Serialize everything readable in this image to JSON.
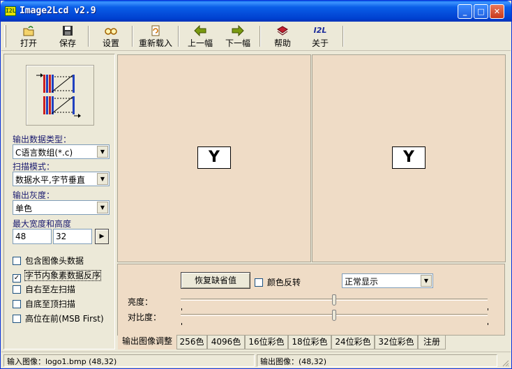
{
  "window": {
    "title": "Image2Lcd v2.9",
    "icon_text": "I2L",
    "min": "_",
    "max": "□",
    "close": "✕"
  },
  "toolbar": [
    {
      "label": "打开",
      "icon": "open-folder-icon"
    },
    {
      "label": "保存",
      "icon": "floppy-disk-icon"
    },
    {
      "label": "设置",
      "icon": "glasses-icon"
    },
    {
      "label": "重新载入",
      "icon": "reload-page-icon"
    },
    {
      "label": "上一幅",
      "icon": "arrow-left-icon"
    },
    {
      "label": "下一幅",
      "icon": "arrow-right-icon"
    },
    {
      "label": "帮助",
      "icon": "help-book-icon"
    },
    {
      "label": "关于",
      "icon": "about-logo-icon",
      "glyph": "I2L"
    }
  ],
  "left": {
    "output_type_label": "输出数据类型：",
    "output_type_value": "C语言数组(*.c)",
    "scan_mode_label": "扫描模式：",
    "scan_mode_value": "数据水平,字节垂直",
    "gray_label": "输出灰度：",
    "gray_value": "单色",
    "size_label": "最大宽度和高度",
    "width": "48",
    "height": "32",
    "apply": "▶",
    "checkboxes": [
      {
        "label": "包含图像头数据",
        "checked": false
      },
      {
        "label": "字节内象素数据反序",
        "checked": true
      },
      {
        "label": "自右至左扫描",
        "checked": false
      },
      {
        "label": "自底至顶扫描",
        "checked": false
      },
      {
        "label": "高位在前(MSB First)",
        "checked": false
      }
    ]
  },
  "preview": {
    "input_glyph": "Y",
    "output_glyph": "Y"
  },
  "adjust": {
    "restore_button": "恢复缺省值",
    "invert_label": "颜色反转",
    "invert_checked": false,
    "display_mode": "正常显示",
    "brightness_label": "亮度：",
    "contrast_label": "对比度：",
    "brightness_level": 0.5,
    "contrast_level": 0.5
  },
  "tabs": [
    "输出图像调整",
    "256色",
    "4096色",
    "16位彩色",
    "18位彩色",
    "24位彩色",
    "32位彩色",
    "注册"
  ],
  "status": {
    "input": "输入图像：logo1.bmp (48,32)",
    "output": "输出图像：(48,32)"
  },
  "colors": {
    "pane_bg": "#efdcc6",
    "title_bar": "#0a5fe8",
    "dialog_bg": "#ece9d8"
  }
}
